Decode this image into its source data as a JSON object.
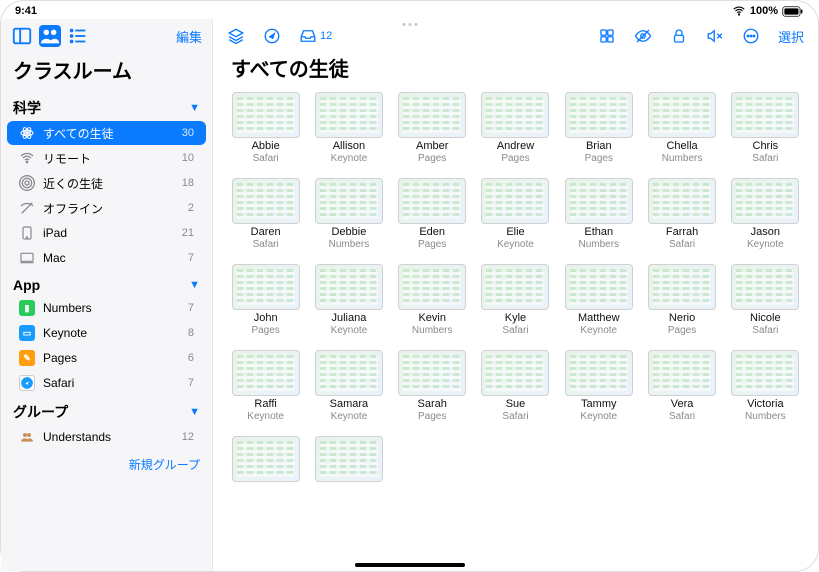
{
  "status": {
    "time": "9:41",
    "battery": "100%"
  },
  "sidebar": {
    "edit": "編集",
    "title": "クラスルーム",
    "sections": [
      {
        "name": "科学",
        "items": [
          {
            "icon": "atom",
            "label": "すべての生徒",
            "count": "30",
            "selected": true
          },
          {
            "icon": "wifi",
            "label": "リモート",
            "count": "10"
          },
          {
            "icon": "near",
            "label": "近くの生徒",
            "count": "18"
          },
          {
            "icon": "offline",
            "label": "オフライン",
            "count": "2"
          },
          {
            "icon": "ipad",
            "label": "iPad",
            "count": "21"
          },
          {
            "icon": "mac",
            "label": "Mac",
            "count": "7"
          }
        ]
      },
      {
        "name": "App",
        "items": [
          {
            "icon": "numbers",
            "label": "Numbers",
            "count": "7"
          },
          {
            "icon": "keynote",
            "label": "Keynote",
            "count": "8"
          },
          {
            "icon": "pages",
            "label": "Pages",
            "count": "6"
          },
          {
            "icon": "safari",
            "label": "Safari",
            "count": "7"
          }
        ]
      },
      {
        "name": "グループ",
        "items": [
          {
            "icon": "group",
            "label": "Understands",
            "count": "12"
          }
        ]
      }
    ],
    "new_group": "新規グループ"
  },
  "toolbar": {
    "inbox_count": "12",
    "select": "選択"
  },
  "content": {
    "title": "すべての生徒",
    "students": [
      {
        "name": "Abbie",
        "app": "Safari"
      },
      {
        "name": "Allison",
        "app": "Keynote"
      },
      {
        "name": "Amber",
        "app": "Pages"
      },
      {
        "name": "Andrew",
        "app": "Pages"
      },
      {
        "name": "Brian",
        "app": "Pages"
      },
      {
        "name": "Chella",
        "app": "Numbers"
      },
      {
        "name": "Chris",
        "app": "Safari"
      },
      {
        "name": "Daren",
        "app": "Safari"
      },
      {
        "name": "Debbie",
        "app": "Numbers"
      },
      {
        "name": "Eden",
        "app": "Pages"
      },
      {
        "name": "Elie",
        "app": "Keynote"
      },
      {
        "name": "Ethan",
        "app": "Numbers"
      },
      {
        "name": "Farrah",
        "app": "Safari"
      },
      {
        "name": "Jason",
        "app": "Keynote"
      },
      {
        "name": "John",
        "app": "Pages"
      },
      {
        "name": "Juliana",
        "app": "Keynote"
      },
      {
        "name": "Kevin",
        "app": "Numbers"
      },
      {
        "name": "Kyle",
        "app": "Safari"
      },
      {
        "name": "Matthew",
        "app": "Keynote"
      },
      {
        "name": "Nerio",
        "app": "Pages"
      },
      {
        "name": "Nicole",
        "app": "Safari"
      },
      {
        "name": "Raffi",
        "app": "Keynote"
      },
      {
        "name": "Samara",
        "app": "Keynote"
      },
      {
        "name": "Sarah",
        "app": "Pages"
      },
      {
        "name": "Sue",
        "app": "Safari"
      },
      {
        "name": "Tammy",
        "app": "Keynote"
      },
      {
        "name": "Vera",
        "app": "Safari"
      },
      {
        "name": "Victoria",
        "app": "Numbers"
      }
    ],
    "extra_students": 2
  }
}
